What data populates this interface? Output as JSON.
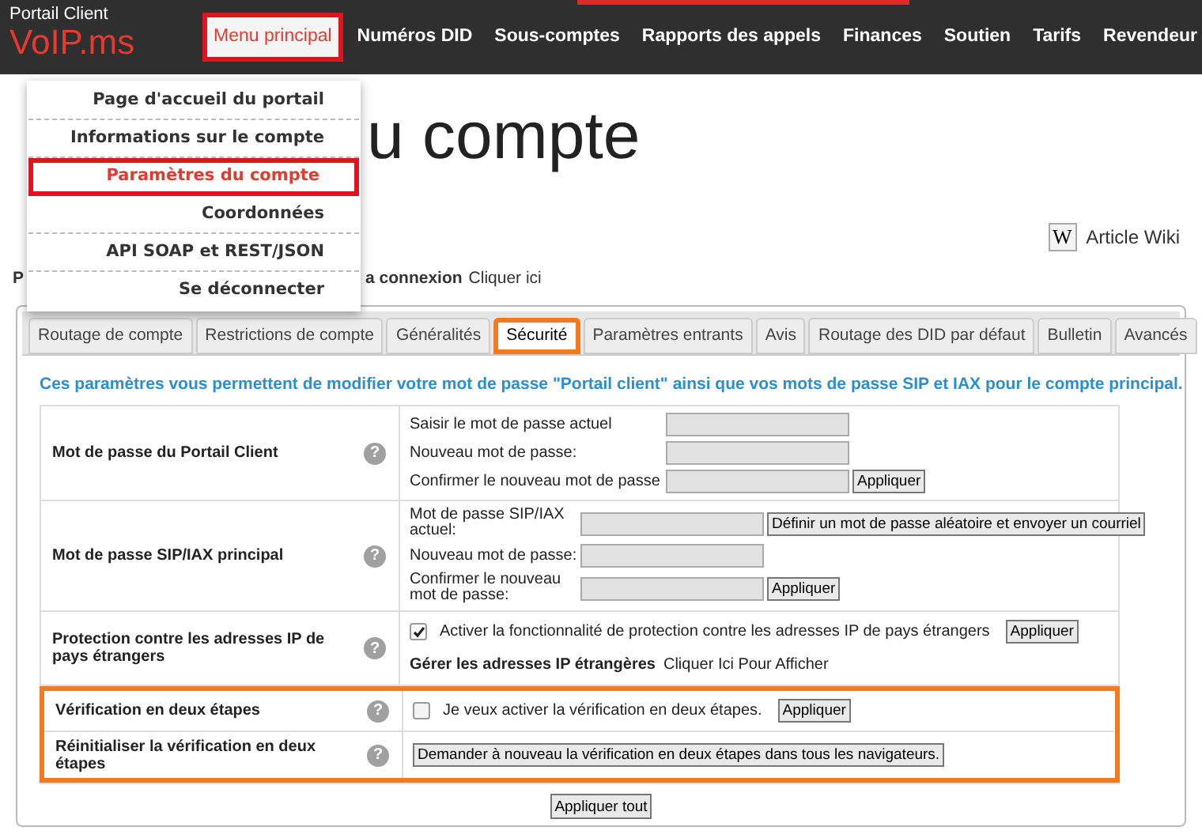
{
  "header": {
    "portal_label": "Portail Client",
    "logo": "VoIP.ms",
    "nav": [
      {
        "label": "Menu principal",
        "selected": true,
        "highlighted": true
      },
      {
        "label": "Numéros DID",
        "selected": false,
        "highlighted": false
      },
      {
        "label": "Sous-comptes",
        "selected": false,
        "highlighted": false
      },
      {
        "label": "Rapports des appels",
        "selected": false,
        "highlighted": false
      },
      {
        "label": "Finances",
        "selected": false,
        "highlighted": false
      },
      {
        "label": "Soutien",
        "selected": false,
        "highlighted": false
      },
      {
        "label": "Tarifs",
        "selected": false,
        "highlighted": false
      },
      {
        "label": "Revendeur",
        "selected": false,
        "highlighted": false
      }
    ]
  },
  "dropdown": {
    "items": [
      {
        "label": "Page d'accueil du portail",
        "selected": false,
        "highlighted": false
      },
      {
        "label": "Informations sur le compte",
        "selected": false,
        "highlighted": false
      },
      {
        "label": "Paramètres du compte",
        "selected": true,
        "highlighted": true
      },
      {
        "label": "Coordonnées",
        "selected": false,
        "highlighted": false
      },
      {
        "label": "API SOAP et REST/JSON",
        "selected": false,
        "highlighted": false
      },
      {
        "label": "Se déconnecter",
        "selected": false,
        "highlighted": false
      }
    ]
  },
  "page_title": "u compte",
  "wiki_icon": "W",
  "wiki_link": "Article Wiki",
  "help_icon": "?",
  "notice_parts": [
    "P",
    "a connexion"
  ],
  "notice_link": "Cliquer ici",
  "tabs": [
    {
      "label": "Routage de compte",
      "selected": false,
      "highlighted": false
    },
    {
      "label": "Restrictions de compte",
      "selected": false,
      "highlighted": false
    },
    {
      "label": "Généralités",
      "selected": false,
      "highlighted": false
    },
    {
      "label": "Sécurité",
      "selected": true,
      "highlighted": true
    },
    {
      "label": "Paramètres entrants",
      "selected": false,
      "highlighted": false
    },
    {
      "label": "Avis",
      "selected": false,
      "highlighted": false
    },
    {
      "label": "Routage des DID par défaut",
      "selected": false,
      "highlighted": false
    },
    {
      "label": "Bulletin",
      "selected": false,
      "highlighted": false
    },
    {
      "label": "Avancés",
      "selected": false,
      "highlighted": false
    }
  ],
  "description": "Ces paramètres vous permettent de modifier votre mot de passe \"Portail client\" ainsi que vos mots de passe SIP et IAX pour le compte principal.",
  "rows": [
    {
      "label": "Mot de passe du Portail Client",
      "highlighted": false,
      "kind": "fields",
      "fields": [
        {
          "label": "Saisir le mot de passe actuel"
        },
        {
          "label": "Nouveau mot de passe:"
        },
        {
          "label": "Confirmer le nouveau mot de passe",
          "button": "Appliquer"
        }
      ]
    },
    {
      "label": "Mot de passe SIP/IAX principal",
      "highlighted": false,
      "kind": "compactfields",
      "fields": [
        {
          "label": "Mot de passe SIP/IAX actuel:",
          "button": "Définir un mot de passe aléatoire et envoyer un courriel"
        },
        {
          "label": "Nouveau mot de passe:"
        },
        {
          "label": "Confirmer le nouveau mot de passe:",
          "button": "Appliquer"
        }
      ]
    },
    {
      "label": "Protection contre les adresses IP de pays étrangers",
      "highlighted": false,
      "kind": "checkbox",
      "checked": true,
      "text": "Activer la fonctionnalité de protection contre les adresses IP de pays étrangers",
      "button": "Appliquer",
      "sub_label": "Gérer les adresses IP étrangères",
      "sub_link": "Cliquer Ici Pour Afficher"
    },
    {
      "label": "Vérification en deux étapes",
      "highlighted": true,
      "kind": "checkbox",
      "checked": false,
      "text": "Je veux activer la vérification en deux étapes.",
      "button": "Appliquer"
    },
    {
      "label": "Réinitialiser la vérification en deux étapes",
      "highlighted": true,
      "kind": "button",
      "button": "Demander à nouveau la vérification en deux étapes dans tous les navigateurs."
    }
  ],
  "apply_all": "Appliquer tout"
}
